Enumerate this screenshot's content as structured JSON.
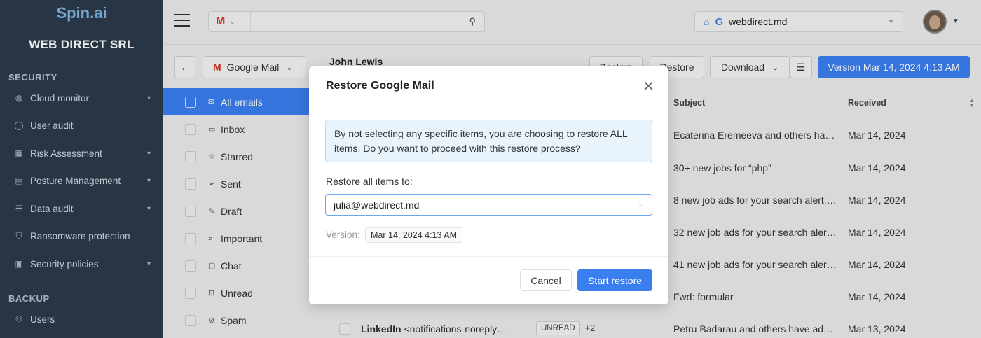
{
  "app": {
    "logo": "Spin.ai",
    "org_name": "WEB DIRECT SRL"
  },
  "sidebar": {
    "sections": [
      {
        "label": "SECURITY"
      },
      {
        "label": "BACKUP"
      }
    ],
    "items": [
      {
        "label": "Cloud monitor",
        "icon": "globe-icon"
      },
      {
        "label": "User audit",
        "icon": "user-icon"
      },
      {
        "label": "Risk Assessment",
        "icon": "grid-icon"
      },
      {
        "label": "Posture Management",
        "icon": "document-icon"
      },
      {
        "label": "Data audit",
        "icon": "list-icon"
      },
      {
        "label": "Ransomware protection",
        "icon": "shield-icon"
      },
      {
        "label": "Security policies",
        "icon": "policy-icon"
      },
      {
        "label": "Users",
        "icon": "users-icon"
      }
    ]
  },
  "topbar": {
    "search_placeholder": "",
    "domain": "webdirect.md"
  },
  "toolbar": {
    "service": "Google Mail",
    "user": "John Lewis",
    "backup_label": "Backup",
    "restore_label": "Restore",
    "download_label": "Download",
    "version_label": "Version Mar 14, 2024 4:13 AM"
  },
  "folders": [
    {
      "label": "All emails",
      "icon": "mail-icon"
    },
    {
      "label": "Inbox",
      "icon": "inbox-icon"
    },
    {
      "label": "Starred",
      "icon": "star-icon"
    },
    {
      "label": "Sent",
      "icon": "send-icon"
    },
    {
      "label": "Draft",
      "icon": "draft-icon"
    },
    {
      "label": "Important",
      "icon": "important-icon"
    },
    {
      "label": "Chat",
      "icon": "chat-icon"
    },
    {
      "label": "Unread",
      "icon": "unread-icon"
    },
    {
      "label": "Spam",
      "icon": "spam-icon"
    }
  ],
  "table": {
    "headers": {
      "subject": "Subject",
      "received": "Received"
    },
    "rows": [
      {
        "subject": "Ecaterina Eremeeva and others hav…",
        "received": "Mar 14, 2024"
      },
      {
        "subject": "30+ new jobs for “php”",
        "received": "Mar 14, 2024"
      },
      {
        "subject": "8 new job ads for your search alert:…",
        "received": "Mar 14, 2024"
      },
      {
        "subject": "32 new job ads for your search aler…",
        "received": "Mar 14, 2024"
      },
      {
        "subject": "41 new job ads for your search aler…",
        "received": "Mar 14, 2024"
      },
      {
        "subject": "Fwd: formular",
        "received": "Mar 14, 2024"
      },
      {
        "subject": "Petru Badarau and others have ad…",
        "received": "Mar 13, 2024"
      }
    ],
    "last_row": {
      "sender_name": "LinkedIn",
      "sender_email": "<notifications-noreply…",
      "badge": "UNREAD",
      "extra": "+2"
    }
  },
  "modal": {
    "title": "Restore Google Mail",
    "info": "By not selecting any specific items, you are choosing to restore ALL items. Do you want to proceed with this restore process?",
    "restore_label": "Restore all items to:",
    "restore_target": "julia@webdirect.md",
    "version_label": "Version:",
    "version_value": "Mar 14, 2024 4:13 AM",
    "cancel_label": "Cancel",
    "start_label": "Start restore"
  },
  "colors": {
    "accent": "#3a7ff0",
    "sidebar_bg": "#2b3a4a",
    "info_bg": "#e8f3fc"
  }
}
